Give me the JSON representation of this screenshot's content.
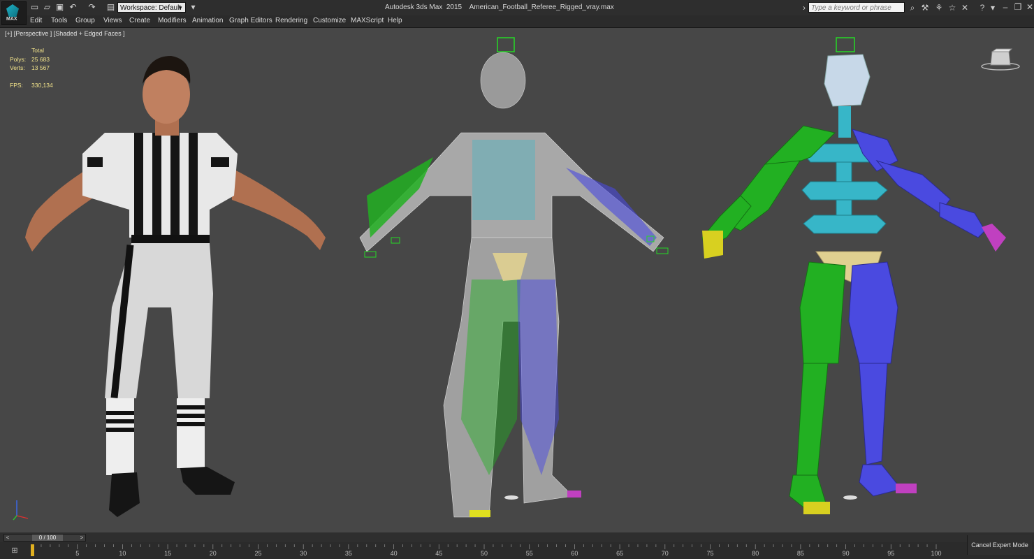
{
  "titlebar": {
    "logo_text": "MAX",
    "workspace_label": "Workspace: Default",
    "app_title": "Autodesk 3ds Max  2015    American_Football_Referee_Rigged_vray.max",
    "search_placeholder": "Type a keyword or phrase"
  },
  "menubar": {
    "items": [
      "Edit",
      "Tools",
      "Group",
      "Views",
      "Create",
      "Modifiers",
      "Animation",
      "Graph Editors",
      "Rendering",
      "Customize",
      "MAXScript",
      "Help"
    ]
  },
  "viewport": {
    "label": "[+] [Perspective ] [Shaded + Edged Faces ]",
    "stats": {
      "header": "Total",
      "polys_label": "Polys:",
      "polys_value": "25 683",
      "verts_label": "Verts:",
      "verts_value": "13 567",
      "fps_label": "FPS:",
      "fps_value": "330,134"
    }
  },
  "timeline": {
    "frame_display": "0 / 100",
    "prev_symbol": "<",
    "next_symbol": ">",
    "ticks": [
      "5",
      "10",
      "15",
      "20",
      "25",
      "30",
      "35",
      "40",
      "45",
      "50",
      "55",
      "60",
      "65",
      "70",
      "75",
      "80",
      "85",
      "90",
      "95",
      "100"
    ],
    "current_frame": 0,
    "max_frame": 100
  },
  "status": {
    "cancel_expert_label": "Cancel Expert Mode"
  },
  "colors": {
    "viewport_bg": "#474747",
    "stats_text": "#f1e28a",
    "rig_green": "#22b022",
    "rig_blue": "#4a4ae0",
    "rig_cyan": "#37b6c8",
    "rig_yellow": "#e0d090",
    "rig_magenta": "#c040c0"
  }
}
